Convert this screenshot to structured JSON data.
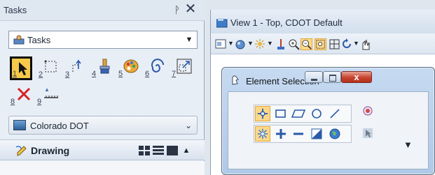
{
  "tasks_panel": {
    "title": "Tasks",
    "pin_glyph": "ᚹ",
    "close_glyph": "✕",
    "task_select": {
      "value": "Tasks",
      "arrow": "▼"
    },
    "tools": [
      {
        "num": "1",
        "icon": "element-selection-arrow-icon",
        "selected": true
      },
      {
        "num": "2",
        "icon": "fence-dashed-rectangle-icon"
      },
      {
        "num": "3",
        "icon": "move-copy-arrows-icon"
      },
      {
        "num": "4",
        "icon": "paint-brush-icon"
      },
      {
        "num": "5",
        "icon": "color-palette-icon"
      },
      {
        "num": "6",
        "icon": "spiral-rotate-icon"
      },
      {
        "num": "7",
        "icon": "scale-arrow-box-icon"
      },
      {
        "num": "8",
        "icon": "delete-red-x-icon"
      },
      {
        "num": "9",
        "icon": "measure-ruler-icon"
      }
    ],
    "workflow": {
      "label": "Colorado DOT",
      "chevron": "⌄"
    },
    "drawing_section": {
      "label": "Drawing",
      "collapse": "▲"
    }
  },
  "view_window": {
    "title": "View 1 - Top, CDOT Default"
  },
  "element_selection": {
    "title": "Element Selection",
    "close_label": "x",
    "more_arrow": "▼"
  },
  "colors": {
    "accent_yellow": "#f5c94a",
    "close_red": "#c7432e",
    "panel_bg": "#e8eef6"
  }
}
